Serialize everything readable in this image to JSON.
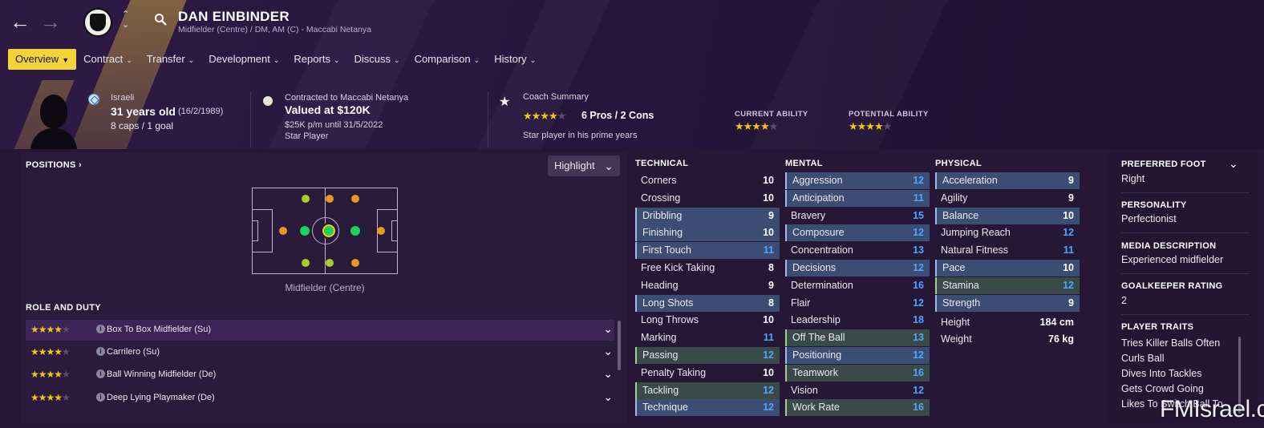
{
  "player": {
    "name": "DAN EINBINDER",
    "subtitle": "Midfielder (Centre) / DM, AM (C) - Maccabi Netanya"
  },
  "menu": [
    {
      "label": "Overview",
      "active": true
    },
    {
      "label": "Contract"
    },
    {
      "label": "Transfer"
    },
    {
      "label": "Development"
    },
    {
      "label": "Reports"
    },
    {
      "label": "Discuss"
    },
    {
      "label": "Comparison"
    },
    {
      "label": "History"
    }
  ],
  "info": {
    "nationality": "Israeli",
    "age": "31 years old",
    "dob": "(16/2/1989)",
    "caps": "8 caps / 1 goal",
    "contract_label": "Contracted to Maccabi Netanya",
    "value": "Valued at $120K",
    "wage": "$25K p/m until 31/5/2022",
    "status": "Star Player",
    "coach_label": "Coach Summary",
    "pros_cons": "6 Pros / 2 Cons",
    "coach_summary": "Star player in his prime years",
    "coach_stars": 4,
    "current_ability_label": "CURRENT ABILITY",
    "current_ability_stars": 4,
    "potential_ability_label": "POTENTIAL ABILITY",
    "potential_ability_stars": 4
  },
  "positions": {
    "title": "POSITIONS",
    "highlight_label": "Highlight",
    "caption": "Midfielder (Centre)"
  },
  "roles": {
    "title": "ROLE AND DUTY",
    "items": [
      {
        "label": "Box To Box Midfielder (Su)",
        "stars": 4,
        "selected": true
      },
      {
        "label": "Carrilero (Su)",
        "stars": 4
      },
      {
        "label": "Ball Winning Midfielder (De)",
        "stars": 4
      },
      {
        "label": "Deep Lying Playmaker (De)",
        "stars": 4
      }
    ]
  },
  "technical": {
    "title": "TECHNICAL",
    "items": [
      {
        "name": "Corners",
        "value": "10",
        "hl": ""
      },
      {
        "name": "Crossing",
        "value": "10",
        "hl": ""
      },
      {
        "name": "Dribbling",
        "value": "9",
        "hl": "blue"
      },
      {
        "name": "Finishing",
        "value": "10",
        "hl": "blue"
      },
      {
        "name": "First Touch",
        "value": "11",
        "hl": "blue"
      },
      {
        "name": "Free Kick Taking",
        "value": "8",
        "hl": ""
      },
      {
        "name": "Heading",
        "value": "9",
        "hl": ""
      },
      {
        "name": "Long Shots",
        "value": "8",
        "hl": "blue"
      },
      {
        "name": "Long Throws",
        "value": "10",
        "hl": ""
      },
      {
        "name": "Marking",
        "value": "11",
        "hl": ""
      },
      {
        "name": "Passing",
        "value": "12",
        "hl": "green"
      },
      {
        "name": "Penalty Taking",
        "value": "10",
        "hl": ""
      },
      {
        "name": "Tackling",
        "value": "12",
        "hl": "green"
      },
      {
        "name": "Technique",
        "value": "12",
        "hl": "blue"
      }
    ]
  },
  "mental": {
    "title": "MENTAL",
    "items": [
      {
        "name": "Aggression",
        "value": "12",
        "hl": "blue"
      },
      {
        "name": "Anticipation",
        "value": "11",
        "hl": "blue"
      },
      {
        "name": "Bravery",
        "value": "15",
        "hl": ""
      },
      {
        "name": "Composure",
        "value": "12",
        "hl": "blue"
      },
      {
        "name": "Concentration",
        "value": "13",
        "hl": ""
      },
      {
        "name": "Decisions",
        "value": "12",
        "hl": "blue"
      },
      {
        "name": "Determination",
        "value": "16",
        "hl": ""
      },
      {
        "name": "Flair",
        "value": "12",
        "hl": ""
      },
      {
        "name": "Leadership",
        "value": "18",
        "hl": ""
      },
      {
        "name": "Off The Ball",
        "value": "13",
        "hl": "green"
      },
      {
        "name": "Positioning",
        "value": "12",
        "hl": "blue"
      },
      {
        "name": "Teamwork",
        "value": "16",
        "hl": "green"
      },
      {
        "name": "Vision",
        "value": "12",
        "hl": ""
      },
      {
        "name": "Work Rate",
        "value": "16",
        "hl": "green"
      }
    ]
  },
  "physical": {
    "title": "PHYSICAL",
    "items": [
      {
        "name": "Acceleration",
        "value": "9",
        "hl": "blue"
      },
      {
        "name": "Agility",
        "value": "9",
        "hl": ""
      },
      {
        "name": "Balance",
        "value": "10",
        "hl": "blue"
      },
      {
        "name": "Jumping Reach",
        "value": "12",
        "hl": ""
      },
      {
        "name": "Natural Fitness",
        "value": "11",
        "hl": ""
      },
      {
        "name": "Pace",
        "value": "10",
        "hl": "blue"
      },
      {
        "name": "Stamina",
        "value": "12",
        "hl": "green"
      },
      {
        "name": "Strength",
        "value": "9",
        "hl": "blue"
      }
    ],
    "height_label": "Height",
    "height": "184 cm",
    "weight_label": "Weight",
    "weight": "76 kg"
  },
  "side": {
    "preferred_foot_label": "PREFERRED FOOT",
    "preferred_foot": "Right",
    "personality_label": "PERSONALITY",
    "personality": "Perfectionist",
    "media_label": "MEDIA DESCRIPTION",
    "media": "Experienced midfielder",
    "gk_label": "GOALKEEPER RATING",
    "gk": "2",
    "traits_label": "PLAYER TRAITS",
    "traits": [
      "Tries Killer Balls Often",
      "Curls Ball",
      "Dives Into Tackles",
      "Gets Crowd Going",
      "Likes To Switch Ball To"
    ]
  },
  "watermark": "FMIsrael.com",
  "colors": {
    "accent": "#f4d43a",
    "star": "#f5c518",
    "blue_value": "#4fa6ff"
  }
}
